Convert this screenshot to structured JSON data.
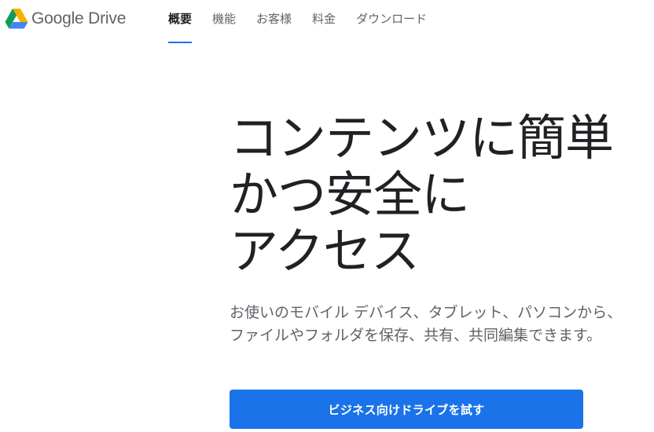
{
  "header": {
    "brand": {
      "logo_icon": "google-drive-logo-icon",
      "google": "Google",
      "product": "Drive"
    },
    "nav": [
      {
        "label": "概要",
        "active": true
      },
      {
        "label": "機能",
        "active": false
      },
      {
        "label": "お客様",
        "active": false
      },
      {
        "label": "料金",
        "active": false
      },
      {
        "label": "ダウンロード",
        "active": false
      }
    ]
  },
  "hero": {
    "title_lines": [
      "コンテンツに簡単",
      "かつ安全に",
      "アクセス"
    ],
    "description": "お使いのモバイル デバイス、タブレット、パソコンから、ファイルやフォルダを保存、共有、共同編集できます。",
    "cta_label": "ビジネス向けドライブを試す"
  },
  "colors": {
    "accent": "#1a73e8",
    "text_primary": "#202124",
    "text_secondary": "#5f6368",
    "logo_green": "#0f9d58",
    "logo_yellow": "#f4b400",
    "logo_blue": "#4285f4"
  }
}
